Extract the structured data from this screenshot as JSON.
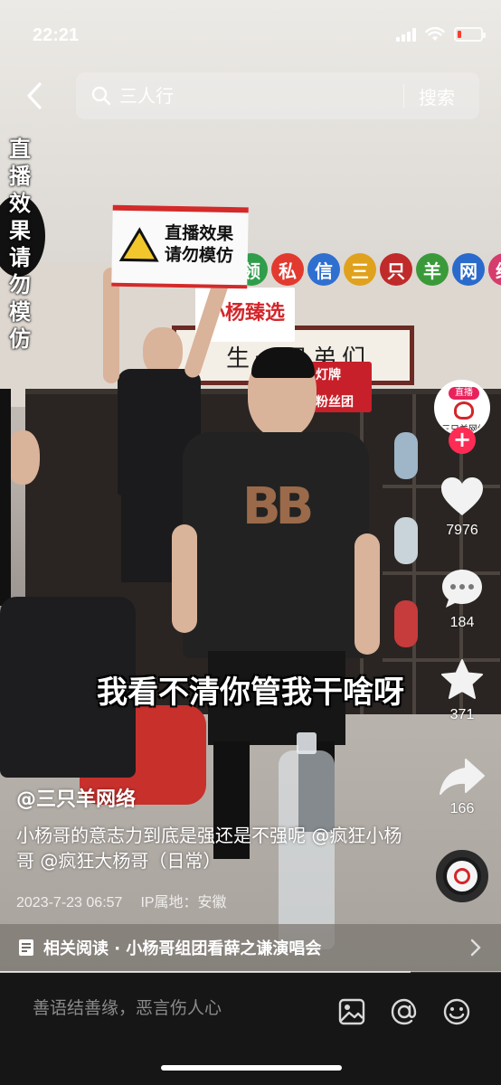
{
  "status_bar": {
    "time": "22:21",
    "battery_color": "#ff3b30"
  },
  "search": {
    "placeholder": "三人行",
    "button": "搜索"
  },
  "side_text": "直播效果请勿模仿",
  "subtitle": "我看不清你管我干啥呀",
  "scene": {
    "sign_text": "直播效果请勿模仿",
    "banner_chars": [
      "领",
      "私",
      "信",
      "三",
      "只",
      "羊",
      "网",
      "络"
    ],
    "banner_colors": [
      "#2f9d4a",
      "#e23a2f",
      "#2f6fd0",
      "#e0a21c",
      "#c02a2a",
      "#3a9a3a",
      "#2a6acc",
      "#d63c6c"
    ],
    "frame_text": "生一兄弟们",
    "logo_board_text": "小杨臻选",
    "red_sign_text": [
      "灯牌",
      "粉丝团"
    ]
  },
  "creator": {
    "live_badge": "直播",
    "avatar_label": "三只羊网络"
  },
  "actions": {
    "likes": "7976",
    "comments": "184",
    "favorites": "371",
    "shares": "166"
  },
  "caption": {
    "author": "@三只羊网络",
    "description": "小杨哥的意志力到底是强还是不强呢 @疯狂小杨哥 @疯狂大杨哥（日常）",
    "date": "2023-7-23 06:57",
    "ip": "IP属地：安徽"
  },
  "related": {
    "text": "相关阅读 · 小杨哥组团看薛之谦演唱会"
  },
  "progress": {
    "value": 0.82
  },
  "comment_bar": {
    "placeholder": "善语结善缘，恶言伤人心"
  },
  "icons": [
    "back-icon",
    "search-icon",
    "heart-icon",
    "comment-icon",
    "star-icon",
    "share-icon",
    "image-icon",
    "at-icon",
    "emoji-icon",
    "document-icon",
    "chevron-right-icon"
  ]
}
